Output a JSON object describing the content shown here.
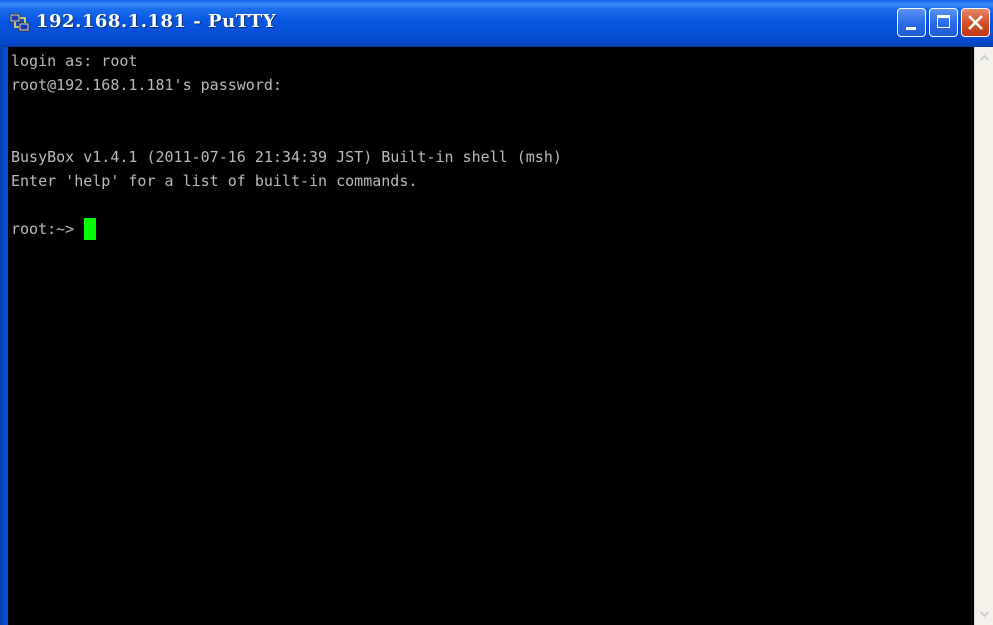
{
  "window": {
    "title": "192.168.1.181 - PuTTY",
    "icon": "putty-network-icon",
    "controls": {
      "minimize": "minimize-icon",
      "maximize": "maximize-icon",
      "close": "close-icon"
    }
  },
  "terminal": {
    "lines": [
      "login as: root",
      "root@192.168.1.181's password:",
      "",
      "",
      "BusyBox v1.4.1 (2011-07-16 21:34:39 JST) Built-in shell (msh)",
      "Enter 'help' for a list of built-in commands.",
      ""
    ],
    "prompt": "root:~>",
    "text_color": "#bbbbbb",
    "background_color": "#000000",
    "cursor_color": "#00ff00"
  },
  "scrollbar": {
    "up_icon": "scroll-up-arrow-icon",
    "down_icon": "scroll-down-arrow-icon"
  }
}
